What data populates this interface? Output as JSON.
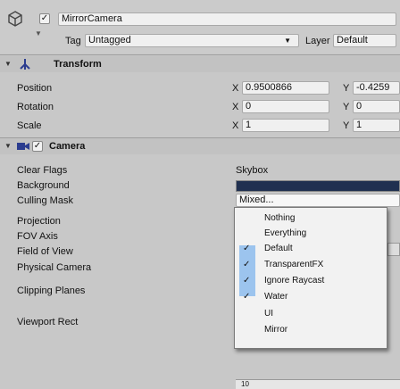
{
  "header": {
    "object_enabled": true,
    "object_name": "MirrorCamera",
    "tag_label": "Tag",
    "tag_value": "Untagged",
    "layer_label": "Layer",
    "layer_value": "Default"
  },
  "transform": {
    "title": "Transform",
    "position_label": "Position",
    "rotation_label": "Rotation",
    "scale_label": "Scale",
    "position": {
      "x": "0.9500866",
      "y": "-0.4259"
    },
    "rotation": {
      "x": "0",
      "y": "0"
    },
    "scale": {
      "x": "1",
      "y": "1"
    },
    "axis_x": "X",
    "axis_y": "Y"
  },
  "camera": {
    "title": "Camera",
    "enabled": true,
    "props": {
      "clear_flags": "Clear Flags",
      "background": "Background",
      "culling_mask": "Culling Mask",
      "projection": "Projection",
      "fov_axis": "FOV Axis",
      "field_of_view": "Field of View",
      "physical_camera": "Physical Camera",
      "clipping_planes": "Clipping Planes",
      "viewport_rect": "Viewport Rect"
    },
    "clear_flags_value": "Skybox",
    "background_color": "#203050",
    "culling_mask_value": "Mixed..."
  },
  "dropdown": {
    "items": [
      {
        "label": "Nothing",
        "checked": false
      },
      {
        "label": "Everything",
        "checked": false
      },
      {
        "label": "Default",
        "checked": true
      },
      {
        "label": "TransparentFX",
        "checked": true
      },
      {
        "label": "Ignore Raycast",
        "checked": true
      },
      {
        "label": "Water",
        "checked": true
      },
      {
        "label": "UI",
        "checked": false
      },
      {
        "label": "Mirror",
        "checked": false
      }
    ],
    "checkmark": "✓",
    "highlight_color": "#9cc4ee"
  },
  "footer": {
    "partial_value": "10"
  }
}
